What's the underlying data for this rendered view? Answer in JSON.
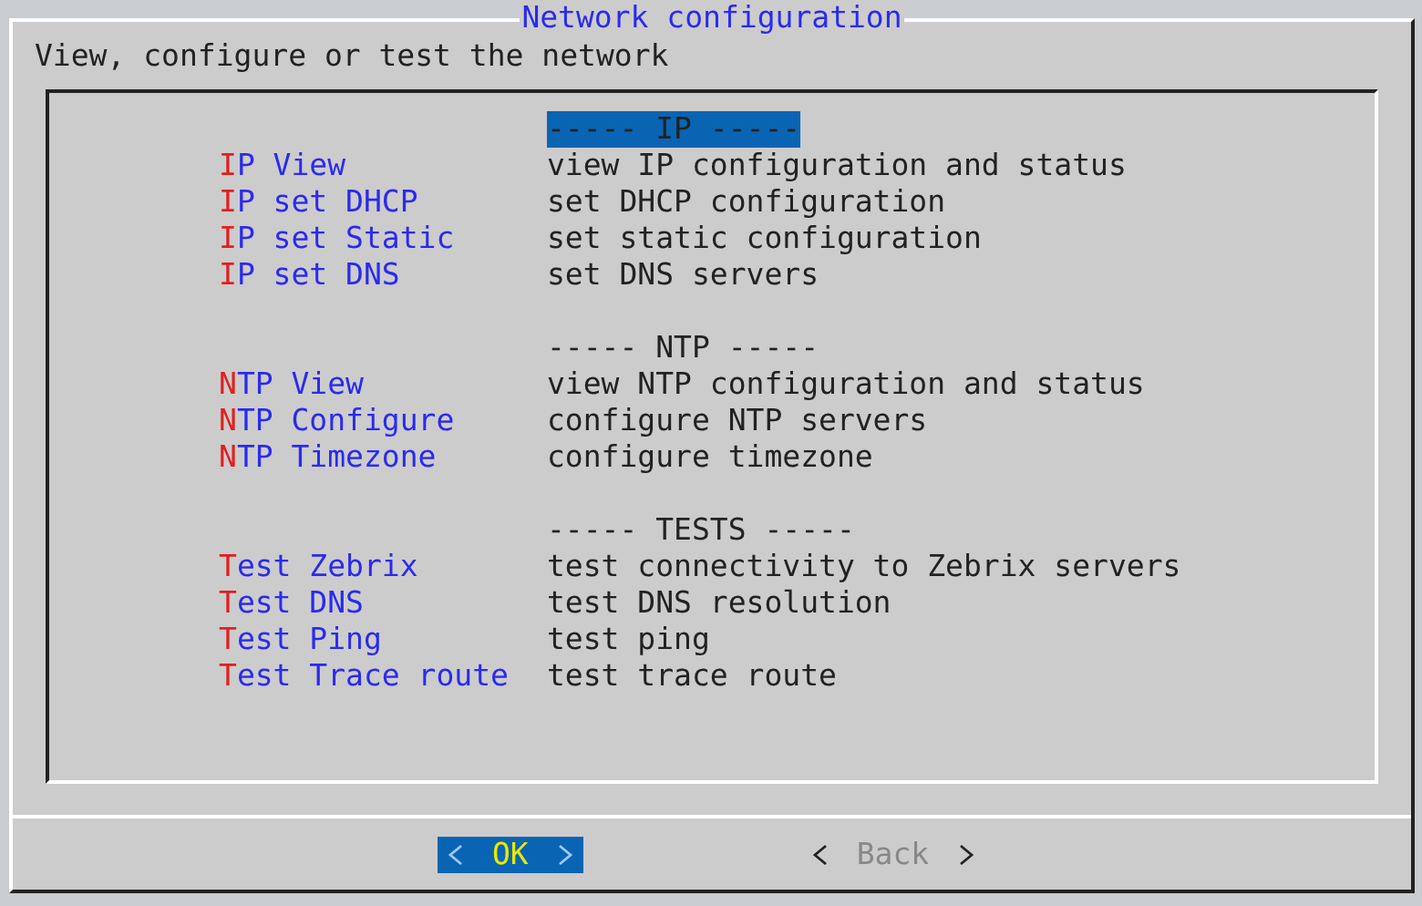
{
  "dialog": {
    "title": "Network configuration",
    "prompt": "View, configure or test the network"
  },
  "menu": [
    {
      "header": "----- IP -----",
      "selected": true,
      "items": [
        {
          "tag": "IP View",
          "description": "view IP configuration and status",
          "selected": false
        },
        {
          "tag": "IP set DHCP",
          "description": "set DHCP configuration",
          "selected": false
        },
        {
          "tag": "IP set Static",
          "description": "set static configuration",
          "selected": false
        },
        {
          "tag": "IP set DNS",
          "description": "set DNS servers",
          "selected": false
        }
      ]
    },
    {
      "header": "----- NTP -----",
      "selected": false,
      "items": [
        {
          "tag": "NTP View",
          "description": "view NTP configuration and status",
          "selected": false
        },
        {
          "tag": "NTP Configure",
          "description": "configure NTP servers",
          "selected": false
        },
        {
          "tag": "NTP Timezone",
          "description": "configure timezone",
          "selected": false
        }
      ]
    },
    {
      "header": "----- TESTS -----",
      "selected": false,
      "items": [
        {
          "tag": "Test Zebrix",
          "description": "test connectivity to Zebrix servers",
          "selected": false
        },
        {
          "tag": "Test DNS",
          "description": "test DNS resolution",
          "selected": false
        },
        {
          "tag": "Test Ping",
          "description": "test ping",
          "selected": false
        },
        {
          "tag": "Test Trace route",
          "description": "test trace route",
          "selected": false
        }
      ]
    }
  ],
  "buttons": [
    {
      "label": "OK",
      "selected": true
    },
    {
      "label": "Back",
      "selected": false
    }
  ]
}
